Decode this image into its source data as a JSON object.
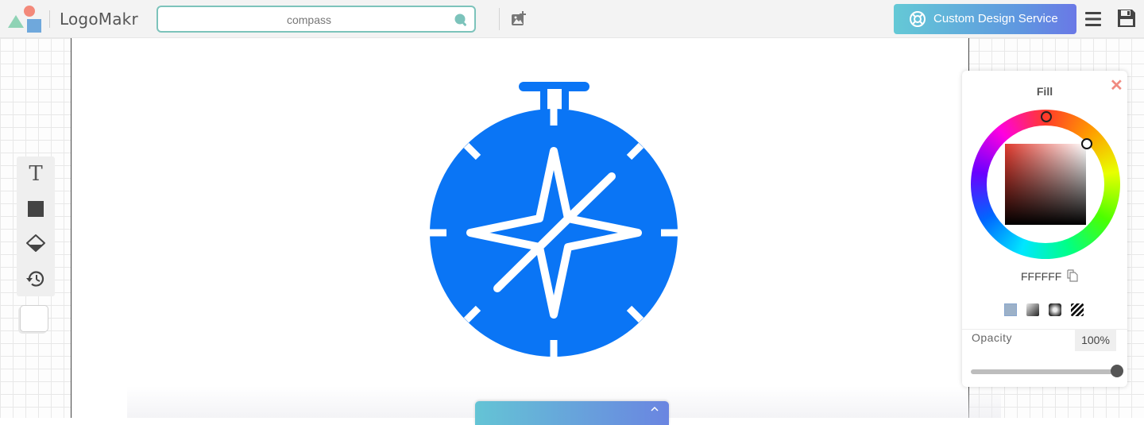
{
  "app": {
    "name": "LogoMakr"
  },
  "search": {
    "value": "compass"
  },
  "header": {
    "cta_label": "Custom Design Service"
  },
  "colors": {
    "accent_teal": "#7cc3bb",
    "compass_blue": "#0a75f5",
    "close_red": "#f08a80"
  },
  "fill_panel": {
    "title": "Fill",
    "hex": "FFFFFF",
    "opacity_label": "Opacity",
    "opacity_value": "100%",
    "opacity_level": 1.0,
    "fill_types": [
      "solid",
      "linear-gradient",
      "radial-gradient",
      "none"
    ]
  },
  "tools": [
    "text-icon",
    "square-shape-icon",
    "fill-bucket-icon",
    "history-icon"
  ]
}
